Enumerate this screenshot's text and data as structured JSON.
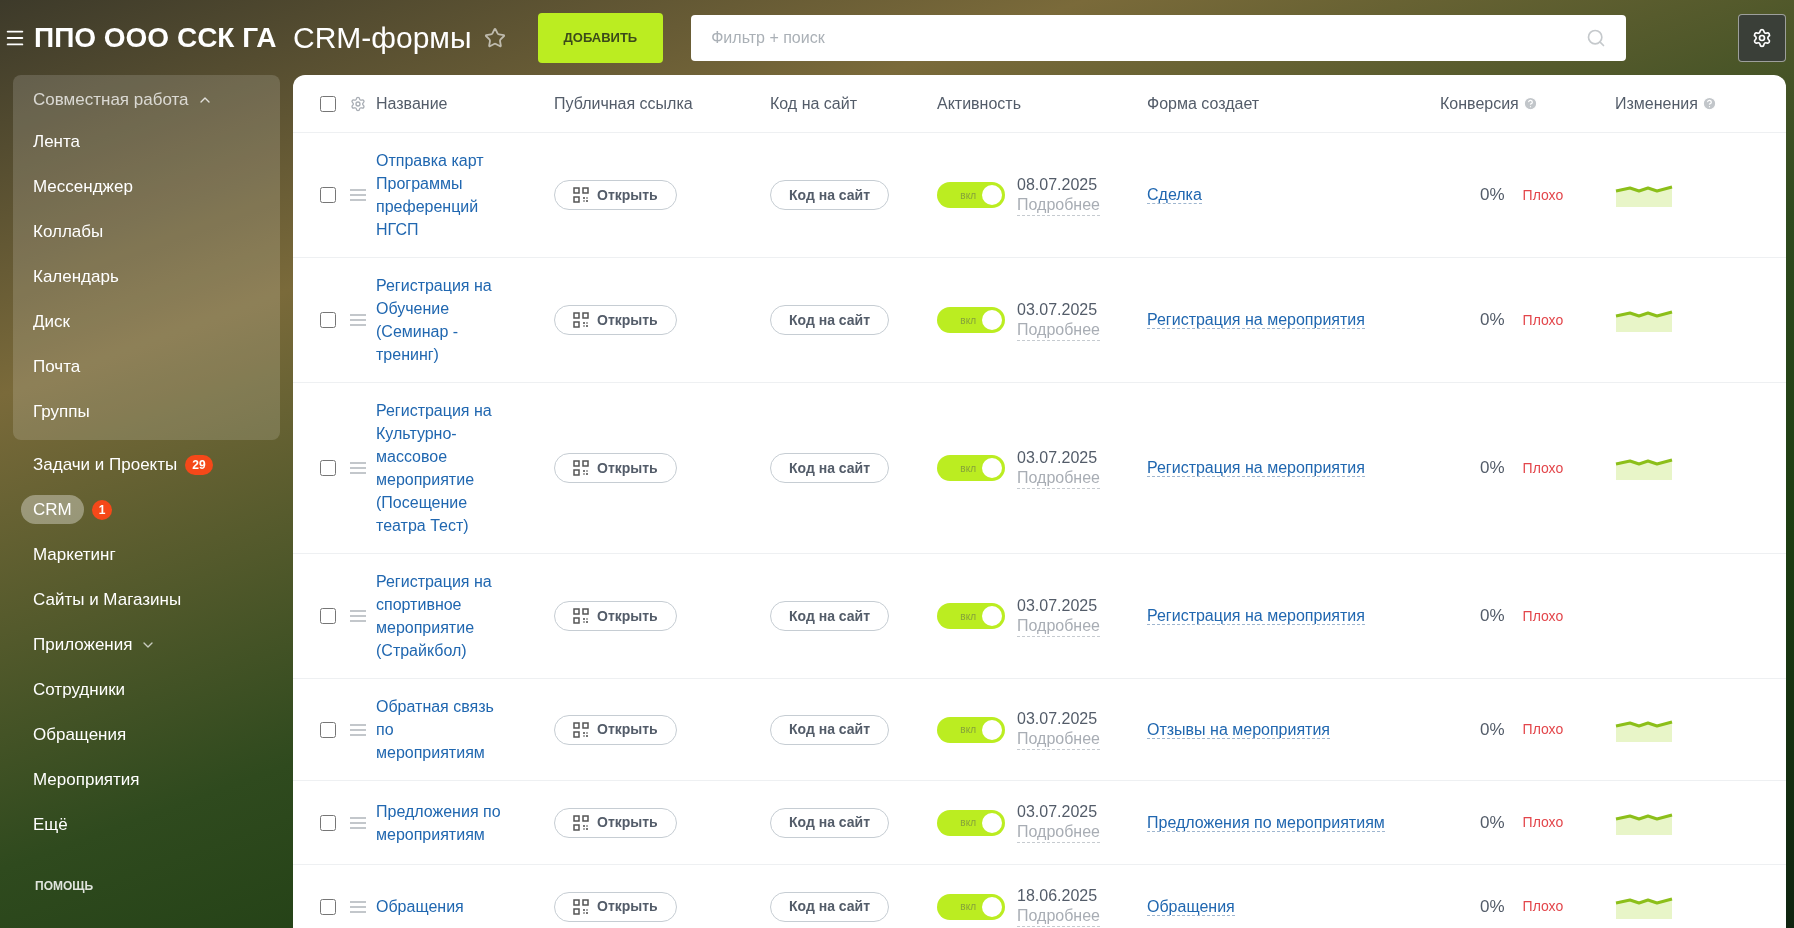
{
  "portal": {
    "title": "ППО ООО ССК ГА"
  },
  "page": {
    "title": "CRM-формы",
    "starred": false,
    "add_button": "ДОБАВИТЬ",
    "search": {
      "placeholder": "Фильтр + поиск"
    }
  },
  "sidebar": {
    "group": {
      "label": "Совместная работа",
      "expanded": true,
      "children": [
        {
          "label": "Лента",
          "selected": false
        },
        {
          "label": "Мессенджер",
          "selected": false
        },
        {
          "label": "Коллабы",
          "selected": false
        },
        {
          "label": "Календарь",
          "selected": false
        },
        {
          "label": "Диск",
          "selected": false
        },
        {
          "label": "Почта",
          "selected": false
        },
        {
          "label": "Группы",
          "selected": false
        }
      ]
    },
    "items": [
      {
        "label": "Задачи и Проекты",
        "selected": false,
        "badge": "29"
      },
      {
        "label": "CRM",
        "selected": true,
        "badge": "1"
      },
      {
        "label": "Маркетинг",
        "selected": false
      },
      {
        "label": "Сайты и Магазины",
        "selected": false
      },
      {
        "label": "Приложения",
        "selected": false,
        "expandable": true
      },
      {
        "label": "Сотрудники",
        "selected": false
      },
      {
        "label": "Обращения",
        "selected": false
      },
      {
        "label": "Мероприятия",
        "selected": false
      },
      {
        "label": "Ещё",
        "selected": false
      }
    ],
    "section": "ПОМОЩЬ"
  },
  "table": {
    "all_checked": false,
    "columns": [
      "Название",
      "Публичная ссылка",
      "Код на сайт",
      "Активность",
      "Форма создает",
      "Конверсия",
      "Изменения"
    ],
    "rows": [
      {
        "name": "Отправка карт Программы преференций НГСП",
        "open": "Открыть",
        "code": "Код на сайт",
        "active": true,
        "toggle": "вкл",
        "date": "08.07.2025",
        "details": "Подробнее",
        "creates": "Сделка",
        "conversion": "0%",
        "rating": "Плохо",
        "sparkline": true,
        "checked": false
      },
      {
        "name": "Регистрация на Обучение (Семинар - тренинг)",
        "open": "Открыть",
        "code": "Код на сайт",
        "active": true,
        "toggle": "вкл",
        "date": "03.07.2025",
        "details": "Подробнее",
        "creates": "Регистрация на мероприятия",
        "conversion": "0%",
        "rating": "Плохо",
        "sparkline": true,
        "checked": false
      },
      {
        "name": "Регистрация на Культурно-массовое мероприятие (Посещение театра Тест)",
        "open": "Открыть",
        "code": "Код на сайт",
        "active": true,
        "toggle": "вкл",
        "date": "03.07.2025",
        "details": "Подробнее",
        "creates": "Регистрация на мероприятия",
        "conversion": "0%",
        "rating": "Плохо",
        "sparkline": true,
        "checked": false
      },
      {
        "name": "Регистрация на спортивное мероприятие (Страйкбол)",
        "open": "Открыть",
        "code": "Код на сайт",
        "active": true,
        "toggle": "вкл",
        "date": "03.07.2025",
        "details": "Подробнее",
        "creates": "Регистрация на мероприятия",
        "conversion": "0%",
        "rating": "Плохо",
        "sparkline": false,
        "checked": false
      },
      {
        "name": "Обратная связь по мероприятиям",
        "open": "Открыть",
        "code": "Код на сайт",
        "active": true,
        "toggle": "вкл",
        "date": "03.07.2025",
        "details": "Подробнее",
        "creates": "Отзывы на мероприятия",
        "conversion": "0%",
        "rating": "Плохо",
        "sparkline": true,
        "checked": false
      },
      {
        "name": "Предложения по мероприятиям",
        "open": "Открыть",
        "code": "Код на сайт",
        "active": true,
        "toggle": "вкл",
        "date": "03.07.2025",
        "details": "Подробнее",
        "creates": "Предложения по мероприятиям",
        "conversion": "0%",
        "rating": "Плохо",
        "sparkline": true,
        "checked": false
      },
      {
        "name": "Обращения",
        "open": "Открыть",
        "code": "Код на сайт",
        "active": true,
        "toggle": "вкл",
        "date": "18.06.2025",
        "details": "Подробнее",
        "creates": "Обращения",
        "conversion": "0%",
        "rating": "Плохо",
        "sparkline": true,
        "checked": false
      }
    ]
  }
}
